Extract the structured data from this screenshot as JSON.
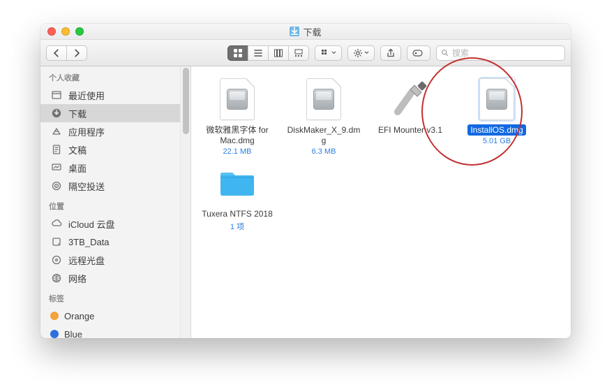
{
  "window": {
    "title": "下载"
  },
  "search": {
    "placeholder": "搜索"
  },
  "sidebar": {
    "sections": [
      {
        "heading": "个人收藏",
        "items": [
          {
            "icon": "recents",
            "label": "最近使用"
          },
          {
            "icon": "downloads",
            "label": "下载",
            "active": true
          },
          {
            "icon": "apps",
            "label": "应用程序"
          },
          {
            "icon": "docs",
            "label": "文稿"
          },
          {
            "icon": "desktop",
            "label": "桌面"
          },
          {
            "icon": "airdrop",
            "label": "隔空投送"
          }
        ]
      },
      {
        "heading": "位置",
        "items": [
          {
            "icon": "icloud",
            "label": "iCloud 云盘"
          },
          {
            "icon": "hdd",
            "label": "3TB_Data"
          },
          {
            "icon": "optical",
            "label": "远程光盘"
          },
          {
            "icon": "network",
            "label": "网络"
          }
        ]
      },
      {
        "heading": "标签",
        "items": [
          {
            "tagColor": "#f2a33c",
            "label": "Orange"
          },
          {
            "tagColor": "#2e6fe0",
            "label": "Blue"
          }
        ]
      }
    ]
  },
  "files": [
    {
      "kind": "dmg",
      "name": "微软雅黑字体 for Mac.dmg",
      "meta": "22.1 MB"
    },
    {
      "kind": "dmg",
      "name": "DiskMaker_X_9.dmg",
      "meta": "6.3 MB"
    },
    {
      "kind": "script",
      "name": "EFI Mounter v3.1",
      "meta": ""
    },
    {
      "kind": "dmg",
      "name": "InstallOS.dmg",
      "meta": "5.01 GB",
      "selected": true
    },
    {
      "kind": "folder",
      "name": "Tuxera NTFS 2018",
      "meta": "1 项"
    }
  ]
}
